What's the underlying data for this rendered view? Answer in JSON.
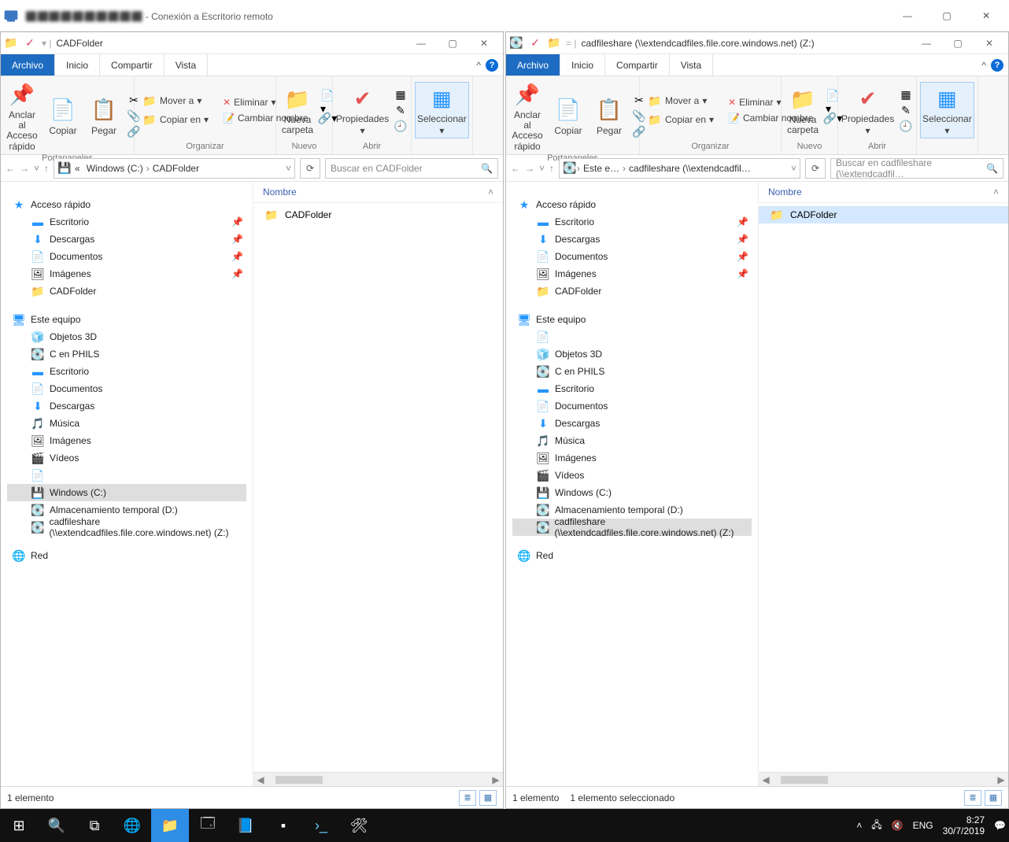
{
  "rdp": {
    "title_suffix": " - Conexión a Escritorio remoto"
  },
  "ribbon": {
    "tabs": [
      "Archivo",
      "Inicio",
      "Compartir",
      "Vista"
    ],
    "pin": "Anclar al\nAcceso rápido",
    "copy": "Copiar",
    "paste": "Pegar",
    "group_clipboard": "Portapapeles",
    "move_to": "Mover a",
    "copy_to": "Copiar en",
    "delete": "Eliminar",
    "rename": "Cambiar nombre",
    "group_organize": "Organizar",
    "new_folder": "Nueva\ncarpeta",
    "group_new": "Nuevo",
    "properties": "Propiedades",
    "group_open": "Abrir",
    "select": "Seleccionar",
    "dropdown_glyph": "▾"
  },
  "columns": {
    "name": "Nombre"
  },
  "tree": {
    "quick": "Acceso rápido",
    "quick_items": [
      "Escritorio",
      "Descargas",
      "Documentos",
      "Imágenes",
      "CADFolder"
    ],
    "this_pc": "Este equipo",
    "pc_items_left": [
      "Objetos 3D",
      "C en PHILS",
      "Escritorio",
      "Documentos",
      "Descargas",
      "Música",
      "Imágenes",
      "Vídeos",
      "",
      "Windows (C:)",
      "Almacenamiento temporal (D:)",
      "cadfileshare (\\\\extendcadfiles.file.core.windows.net) (Z:)"
    ],
    "pc_items_right": [
      "",
      "Objetos 3D",
      "C en PHILS",
      "Escritorio",
      "Documentos",
      "Descargas",
      "Música",
      "Imágenes",
      "Vídeos",
      "Windows (C:)",
      "Almacenamiento temporal (D:)",
      "cadfileshare (\\\\extendcadfiles.file.core.windows.net) (Z:)"
    ],
    "network": "Red"
  },
  "left": {
    "title": "CADFolder",
    "breadcrumb": [
      "«",
      "Windows (C:)",
      "›",
      "CADFolder"
    ],
    "search_placeholder": "Buscar en CADFolder",
    "selected_tree_idx": 9,
    "files": [
      "CADFolder"
    ],
    "file_selected": -1,
    "status1": "1 elemento"
  },
  "right": {
    "title": "cadfileshare (\\\\extendcadfiles.file.core.windows.net) (Z:)",
    "breadcrumb": [
      "›",
      "Este e…",
      "›",
      "cadfileshare (\\\\extendcadfil…"
    ],
    "search_placeholder": "Buscar en cadfileshare (\\\\extendcadfil…",
    "selected_tree_idx": 11,
    "files": [
      "CADFolder"
    ],
    "file_selected": 0,
    "status1": "1 elemento",
    "status2": "1 elemento seleccionado"
  },
  "taskbar": {
    "lang": "ENG",
    "time": "8:27",
    "date": "30/7/2019"
  }
}
